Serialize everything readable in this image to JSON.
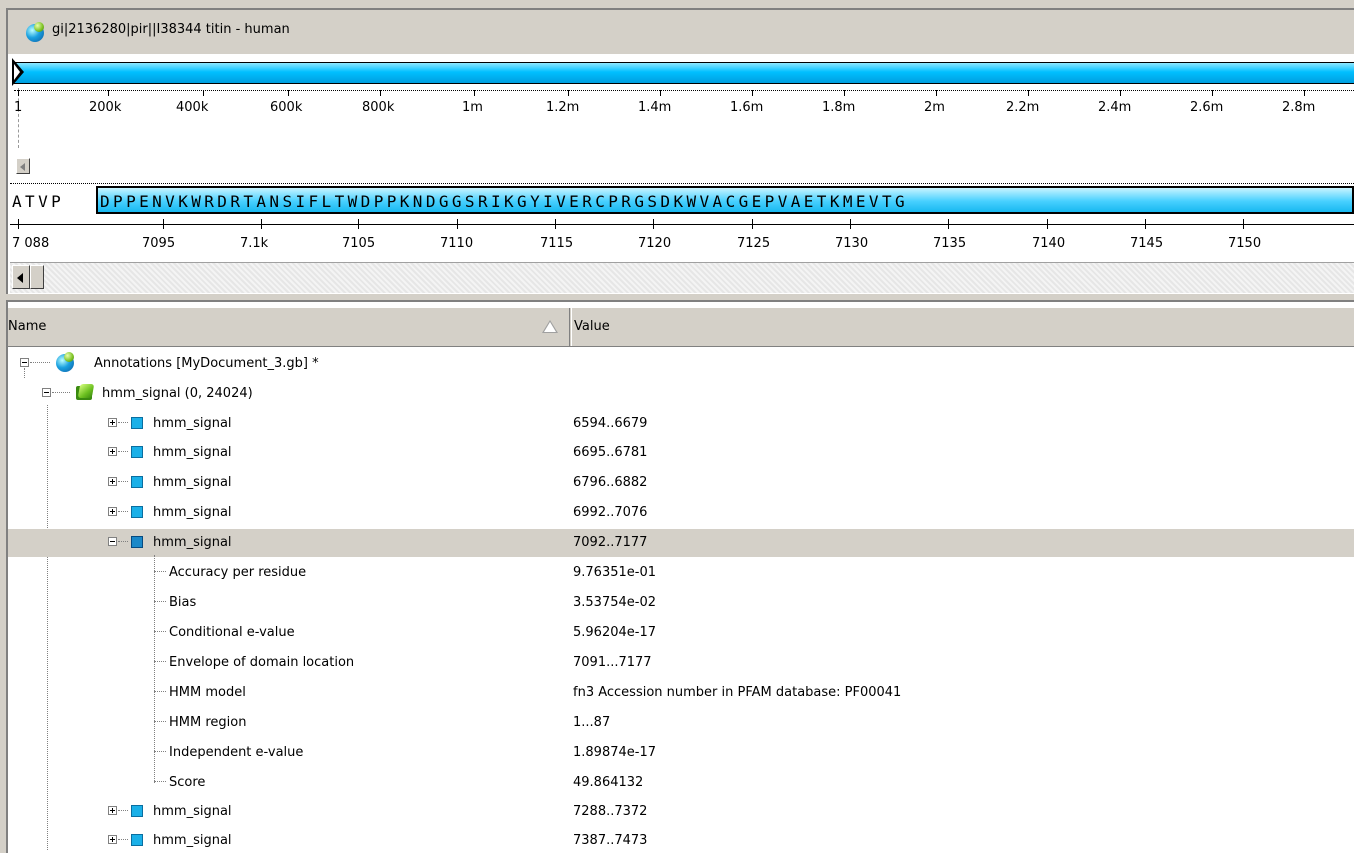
{
  "sequence_view": {
    "title": "gi|2136280|pir||I38344 titin - human",
    "overview_ticks": [
      "1",
      "200k",
      "400k",
      "600k",
      "800k",
      "1m",
      "1.2m",
      "1.4m",
      "1.6m",
      "1.8m",
      "2m",
      "2.2m",
      "2.4m",
      "2.6m",
      "2.8m"
    ],
    "sequence_prefix": "ATVP",
    "sequence_highlight": "DPPENVKWRDRTANSIFLTWDPPKNDGGSRIKGYIVERCPRGSDKWVACGEPVAETKMEVTG",
    "detail_ticks": [
      "7 088",
      "7095",
      "7.1k",
      "7105",
      "7110",
      "7115",
      "7120",
      "7125",
      "7130",
      "7135",
      "7140",
      "7145",
      "7150"
    ],
    "highlight_color": "#18b8f0"
  },
  "tree": {
    "columns": {
      "name": "Name",
      "value": "Value"
    },
    "root": {
      "label": "Annotations [MyDocument_3.gb] *"
    },
    "group": {
      "label": "hmm_signal  (0, 24024)"
    },
    "items": [
      {
        "label": "hmm_signal",
        "value": "6594..6679"
      },
      {
        "label": "hmm_signal",
        "value": "6695..6781"
      },
      {
        "label": "hmm_signal",
        "value": "6796..6882"
      },
      {
        "label": "hmm_signal",
        "value": "6992..7076"
      },
      {
        "label": "hmm_signal",
        "value": "7092..7177"
      },
      {
        "label": "hmm_signal",
        "value": "7288..7372"
      },
      {
        "label": "hmm_signal",
        "value": "7387..7473"
      }
    ],
    "qualifiers": [
      {
        "label": "Accuracy per residue",
        "value": "9.76351e-01"
      },
      {
        "label": "Bias",
        "value": "3.53754e-02"
      },
      {
        "label": "Conditional e-value",
        "value": "5.96204e-17"
      },
      {
        "label": "Envelope of domain location",
        "value": "7091...7177"
      },
      {
        "label": "HMM model",
        "value": "fn3  Accession number in PFAM database: PF00041"
      },
      {
        "label": "HMM region",
        "value": "1...87"
      },
      {
        "label": "Independent e-value",
        "value": "1.89874e-17"
      },
      {
        "label": "Score",
        "value": "49.864132"
      }
    ]
  }
}
